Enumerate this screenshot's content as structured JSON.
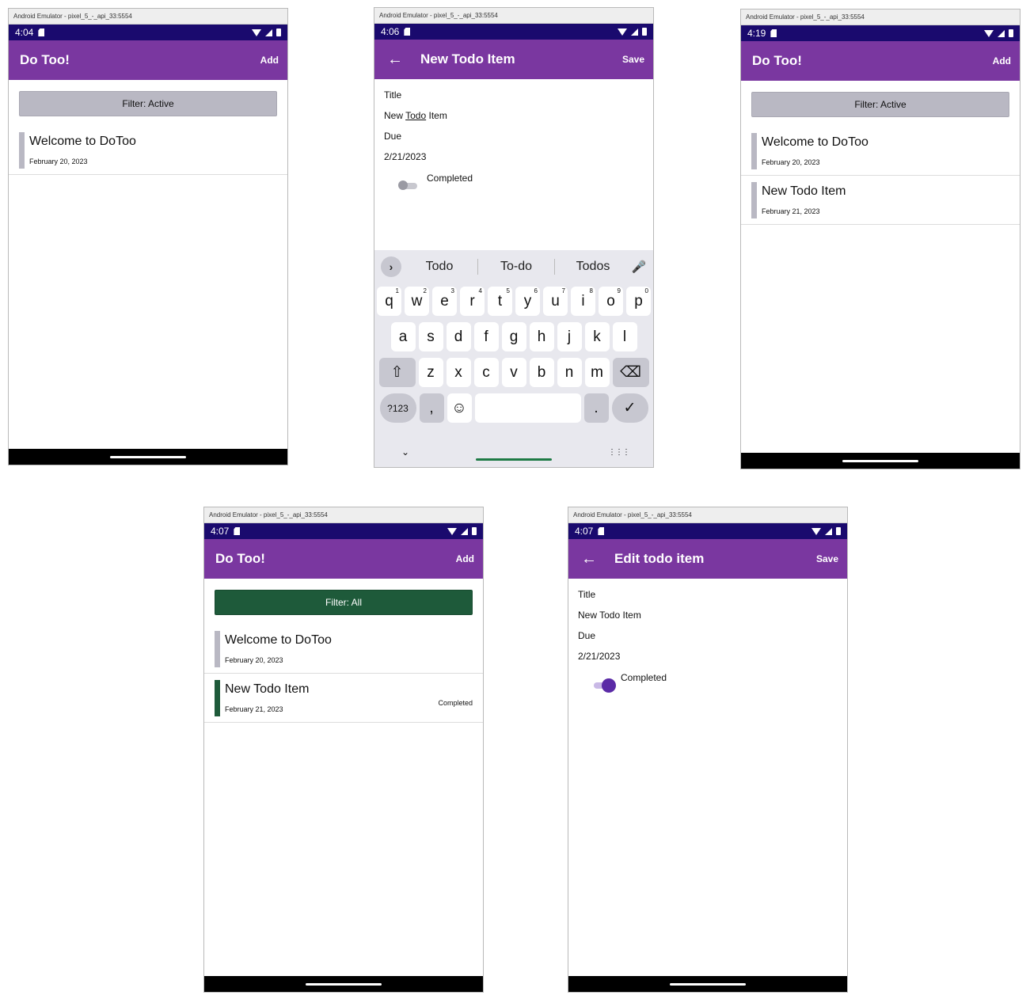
{
  "emulator_title": "Android Emulator - pixel_5_-_api_33:5554",
  "screens": [
    {
      "time": "4:04",
      "app_title": "Do Too!",
      "action": "Add",
      "filter": "Filter: Active",
      "items": [
        {
          "title": "Welcome to DoToo",
          "date": "February 20, 2023"
        }
      ]
    },
    {
      "time": "4:06",
      "app_title": "New Todo Item",
      "action": "Save",
      "form": {
        "title_label": "Title",
        "title_value_pre": "New ",
        "title_value_ul": "Todo",
        "title_value_post": " Item",
        "due_label": "Due",
        "due_value": "2/21/2023",
        "completed_label": "Completed",
        "completed_on": false
      },
      "keyboard": {
        "suggestions": [
          "Todo",
          "To-do",
          "Todos"
        ],
        "row1": [
          "q",
          "w",
          "e",
          "r",
          "t",
          "y",
          "u",
          "i",
          "o",
          "p"
        ],
        "row1_nums": [
          "1",
          "2",
          "3",
          "4",
          "5",
          "6",
          "7",
          "8",
          "9",
          "0"
        ],
        "row2": [
          "a",
          "s",
          "d",
          "f",
          "g",
          "h",
          "j",
          "k",
          "l"
        ],
        "row3": [
          "z",
          "x",
          "c",
          "v",
          "b",
          "n",
          "m"
        ],
        "sym_key": "?123",
        "comma": ",",
        "period": "."
      }
    },
    {
      "time": "4:19",
      "app_title": "Do Too!",
      "action": "Add",
      "filter": "Filter: Active",
      "items": [
        {
          "title": "Welcome to DoToo",
          "date": "February 20, 2023"
        },
        {
          "title": "New Todo Item",
          "date": "February 21, 2023"
        }
      ]
    },
    {
      "time": "4:07",
      "app_title": "Do Too!",
      "action": "Add",
      "filter": "Filter: All",
      "items": [
        {
          "title": "Welcome to DoToo",
          "date": "February 20, 2023"
        },
        {
          "title": "New Todo Item",
          "date": "February 21, 2023",
          "status": "Completed"
        }
      ]
    },
    {
      "time": "4:07",
      "app_title": "Edit todo item",
      "action": "Save",
      "form": {
        "title_label": "Title",
        "title_value": "New Todo Item",
        "due_label": "Due",
        "due_value": "2/21/2023",
        "completed_label": "Completed",
        "completed_on": true
      }
    }
  ],
  "colors": {
    "app_bar": "#7a37a0",
    "status_bar": "#1a0a6e",
    "filter_active": "#b9b8c3",
    "filter_all": "#1e5a3a",
    "completed_bar": "#1e5a3a",
    "toggle_on": "#5a2aa6"
  },
  "icons": [
    "sd-card-icon",
    "wifi-icon",
    "signal-icon",
    "battery-icon",
    "back-arrow-icon",
    "chevron-right-icon",
    "mic-icon",
    "shift-icon",
    "backspace-icon",
    "emoji-icon",
    "check-icon",
    "keyboard-hide-icon",
    "keyboard-grid-icon"
  ]
}
